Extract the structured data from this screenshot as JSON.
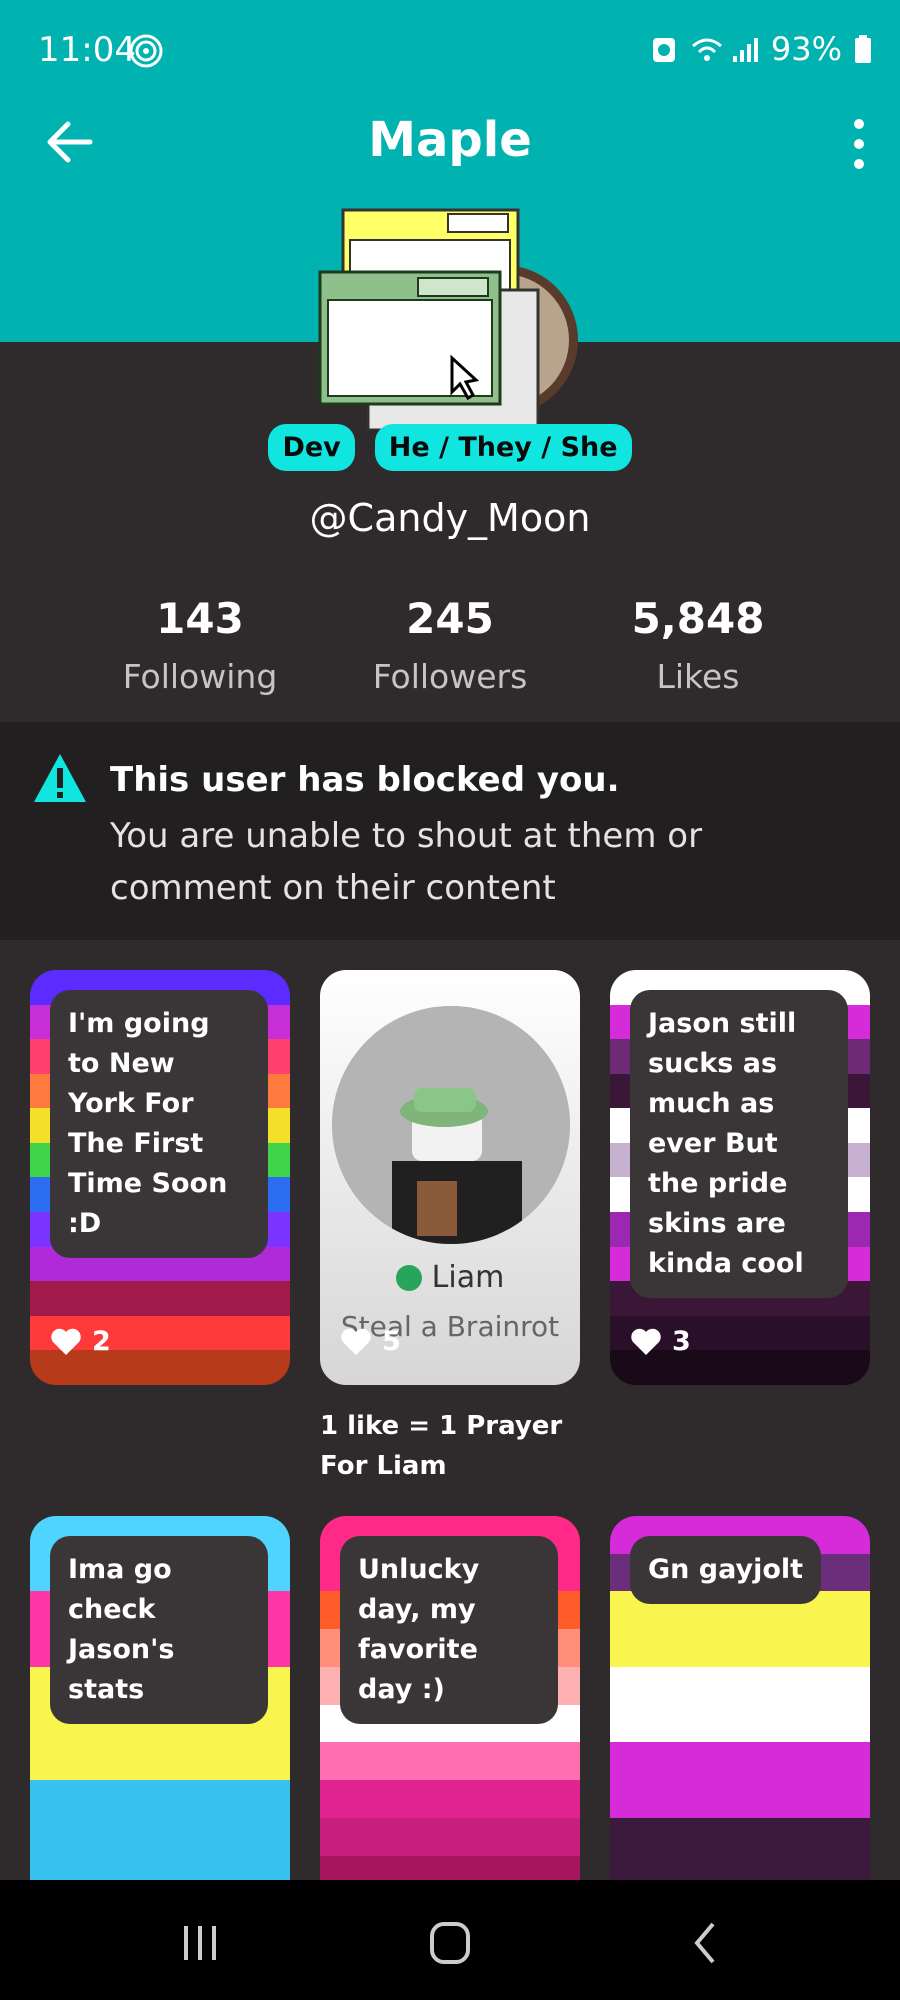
{
  "status_bar": {
    "time": "11:04",
    "battery": "93%"
  },
  "app_bar": {
    "title": "Maple"
  },
  "profile": {
    "badges": [
      "Dev",
      "He / They / She"
    ],
    "username": "@Candy_Moon"
  },
  "stats": [
    {
      "value": "143",
      "label": "Following"
    },
    {
      "value": "245",
      "label": "Followers"
    },
    {
      "value": "5,848",
      "label": "Likes"
    }
  ],
  "blocked_notice": {
    "title": "This user has blocked you.",
    "description": "You are unable to shout at them or comment on their content"
  },
  "posts": [
    {
      "text": "I'm going to New York For The First Time Soon :D",
      "likes": "2",
      "stripes": [
        "#5c2bff",
        "#c62fd6",
        "#ff3f6e",
        "#ff7a3e",
        "#f4e02a",
        "#3fd44a",
        "#2d6df2",
        "#7b33ff",
        "#b02bd8",
        "#a01b4a",
        "#ff3a3a",
        "#b73b1a"
      ]
    },
    {
      "profile_name": "Liam",
      "profile_game": "Steal a Brainrot",
      "likes": "5",
      "caption": "1 like = 1 Prayer For Liam"
    },
    {
      "text": "Jason still sucks as much as ever But the pride skins are kinda cool",
      "likes": "3",
      "stripes": [
        "#ffffff",
        "#d52bd9",
        "#6f2a76",
        "#3a1736",
        "#ffffff",
        "#c7b1d1",
        "#ffffff",
        "#9c27b0",
        "#d52bd9",
        "#3a1736",
        "#2a0f28",
        "#1a0a19"
      ]
    },
    {
      "text": "Ima go check Jason's stats",
      "stripes": [
        "#4fd4ff",
        "#4fd4ff",
        "#ff36a5",
        "#ff36a5",
        "#f9f54f",
        "#f9f54f",
        "#f9f54f",
        "#37c2f0",
        "#37c2f0",
        "#37c2f0",
        "#ff36a5"
      ]
    },
    {
      "text": "Unlucky day, my favorite day :)",
      "stripes": [
        "#ff2a88",
        "#ff2a88",
        "#ff5c2a",
        "#ff8f7a",
        "#ffb0b0",
        "#ffffff",
        "#ff6fb0",
        "#e0238f",
        "#c81e7e",
        "#a7155f",
        "#7a0f44"
      ]
    },
    {
      "text": "Gn gayjolt",
      "stripes": [
        "#d52bd9",
        "#6a2e7a",
        "#f9f54f",
        "#f9f54f",
        "#ffffff",
        "#ffffff",
        "#d52bd9",
        "#d52bd9",
        "#3b1a3e",
        "#3b1a3e",
        "#f9f54f"
      ]
    }
  ]
}
